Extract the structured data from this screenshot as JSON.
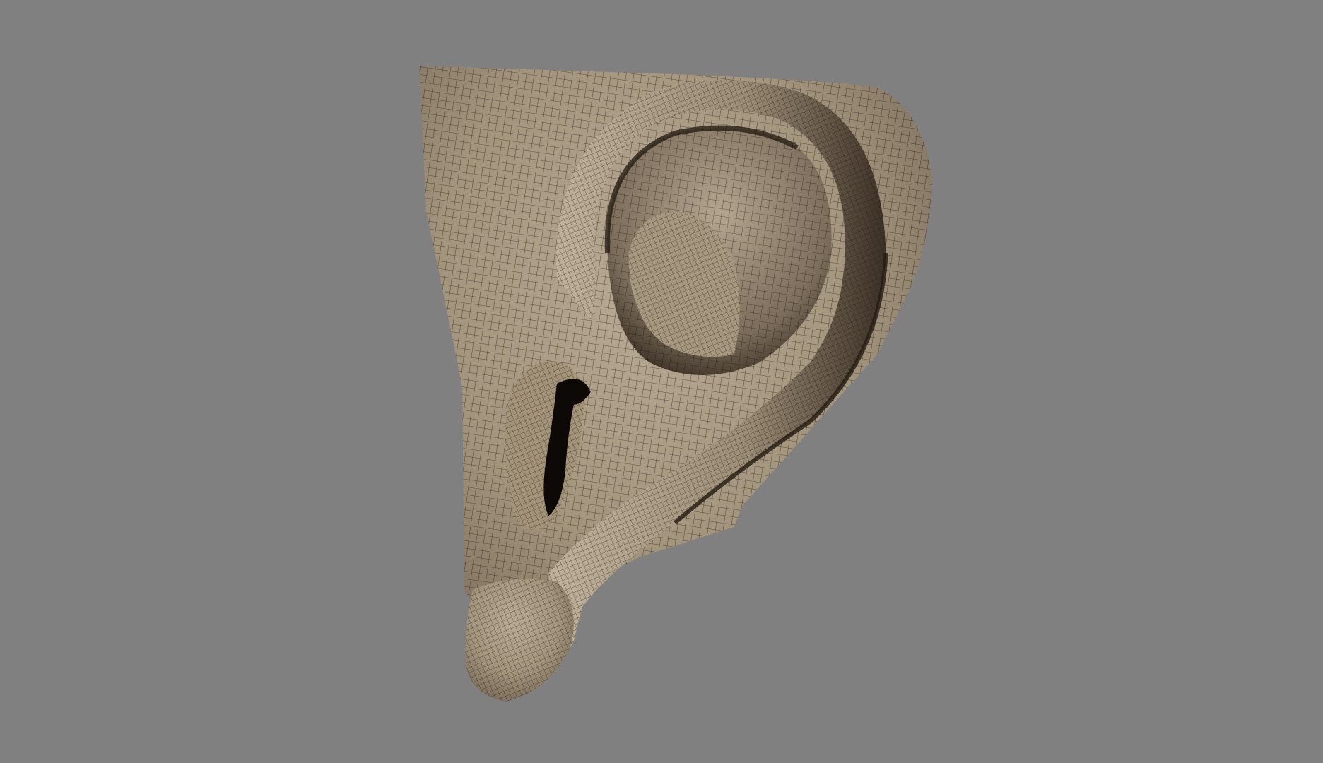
{
  "viewport": {
    "background": "#808080",
    "model": {
      "subject": "ear-mesh",
      "display_mode": "wireframe-on-shaded",
      "surface_color": "#a89a84",
      "shadow_color": "#2a2118",
      "wire_color": "#1c160f"
    }
  }
}
